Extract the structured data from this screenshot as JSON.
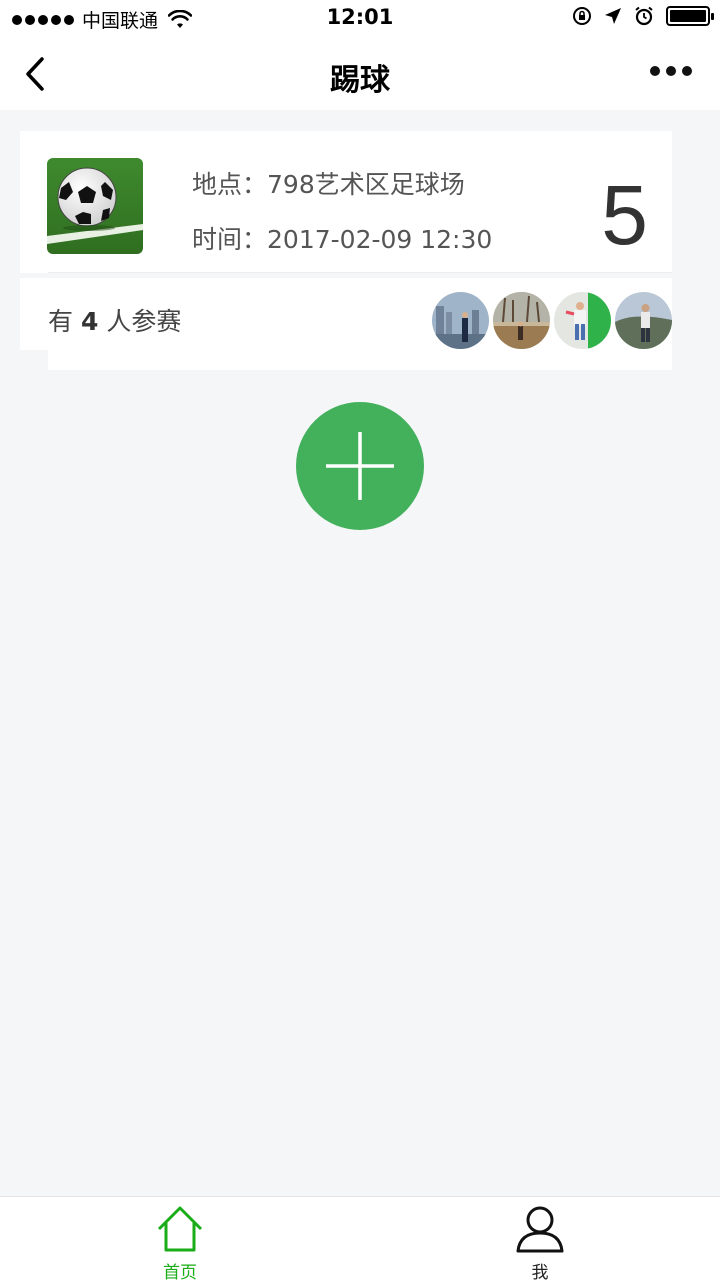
{
  "status_bar": {
    "carrier": "中国联通",
    "time": "12:01",
    "icons": [
      "signal-dots-icon",
      "wifi-icon",
      "orientation-lock-icon",
      "location-arrow-icon",
      "alarm-icon",
      "battery-icon"
    ],
    "battery_level": 1.0
  },
  "nav": {
    "title": "踢球",
    "back_icon": "chevron-left-icon",
    "more_icon": "more-dots-icon"
  },
  "event": {
    "location_label": "地点：",
    "location": "798艺术区足球场",
    "time_label": "时间：",
    "time": "2017-02-09 12:30",
    "count": "5",
    "thumbnail": "soccer-ball-image",
    "participants_prefix": "有",
    "participants_count": "4",
    "participants_suffix": "人参赛",
    "avatars": [
      "avatar-1",
      "avatar-2",
      "avatar-3",
      "avatar-4"
    ]
  },
  "add_button": {
    "icon": "plus-icon"
  },
  "colors": {
    "accent_green": "#43b05c",
    "tab_active": "#1aad19",
    "background": "#f5f6f8"
  },
  "tab_bar": {
    "tabs": [
      {
        "label": "首页",
        "icon": "home-icon",
        "active": true
      },
      {
        "label": "我",
        "icon": "user-icon",
        "active": false
      }
    ]
  }
}
